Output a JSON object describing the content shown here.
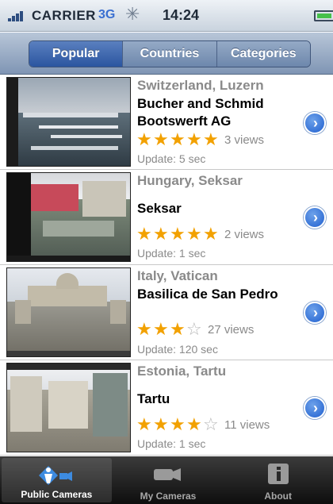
{
  "status_bar": {
    "carrier": "CARRIER",
    "network": "3G",
    "activity_glyph": "✳",
    "time": "14:24"
  },
  "header": {
    "segments": [
      {
        "label": "Popular",
        "selected": true
      },
      {
        "label": "Countries",
        "selected": false
      },
      {
        "label": "Categories",
        "selected": false
      }
    ]
  },
  "cameras": [
    {
      "location": "Switzerland, Luzern",
      "title": "Bucher and Schmid Bootswerft AG",
      "stars": 5,
      "views": "3 views",
      "update": "Update: 5 sec"
    },
    {
      "location": "Hungary, Seksar",
      "title": "Seksar",
      "stars": 5,
      "views": "2 views",
      "update": "Update: 1 sec"
    },
    {
      "location": "Italy, Vatican",
      "title": "Basilica de San Pedro",
      "stars": 3,
      "views": "27 views",
      "update": "Update: 120 sec"
    },
    {
      "location": "Estonia, Tartu",
      "title": "Tartu",
      "stars": 4,
      "views": "11 views",
      "update": "Update: 1 sec"
    }
  ],
  "tabbar": {
    "tabs": [
      {
        "label": "Public Cameras",
        "icon": "public-camera-icon",
        "selected": true
      },
      {
        "label": "My Cameras",
        "icon": "camera-icon",
        "selected": false
      },
      {
        "label": "About",
        "icon": "info-icon",
        "selected": false
      }
    ]
  },
  "colors": {
    "star": "#f2a100",
    "star_empty": "#b7b7b7",
    "segment_selected": "#2b55a0",
    "tabbar": "#1a1a1a"
  }
}
